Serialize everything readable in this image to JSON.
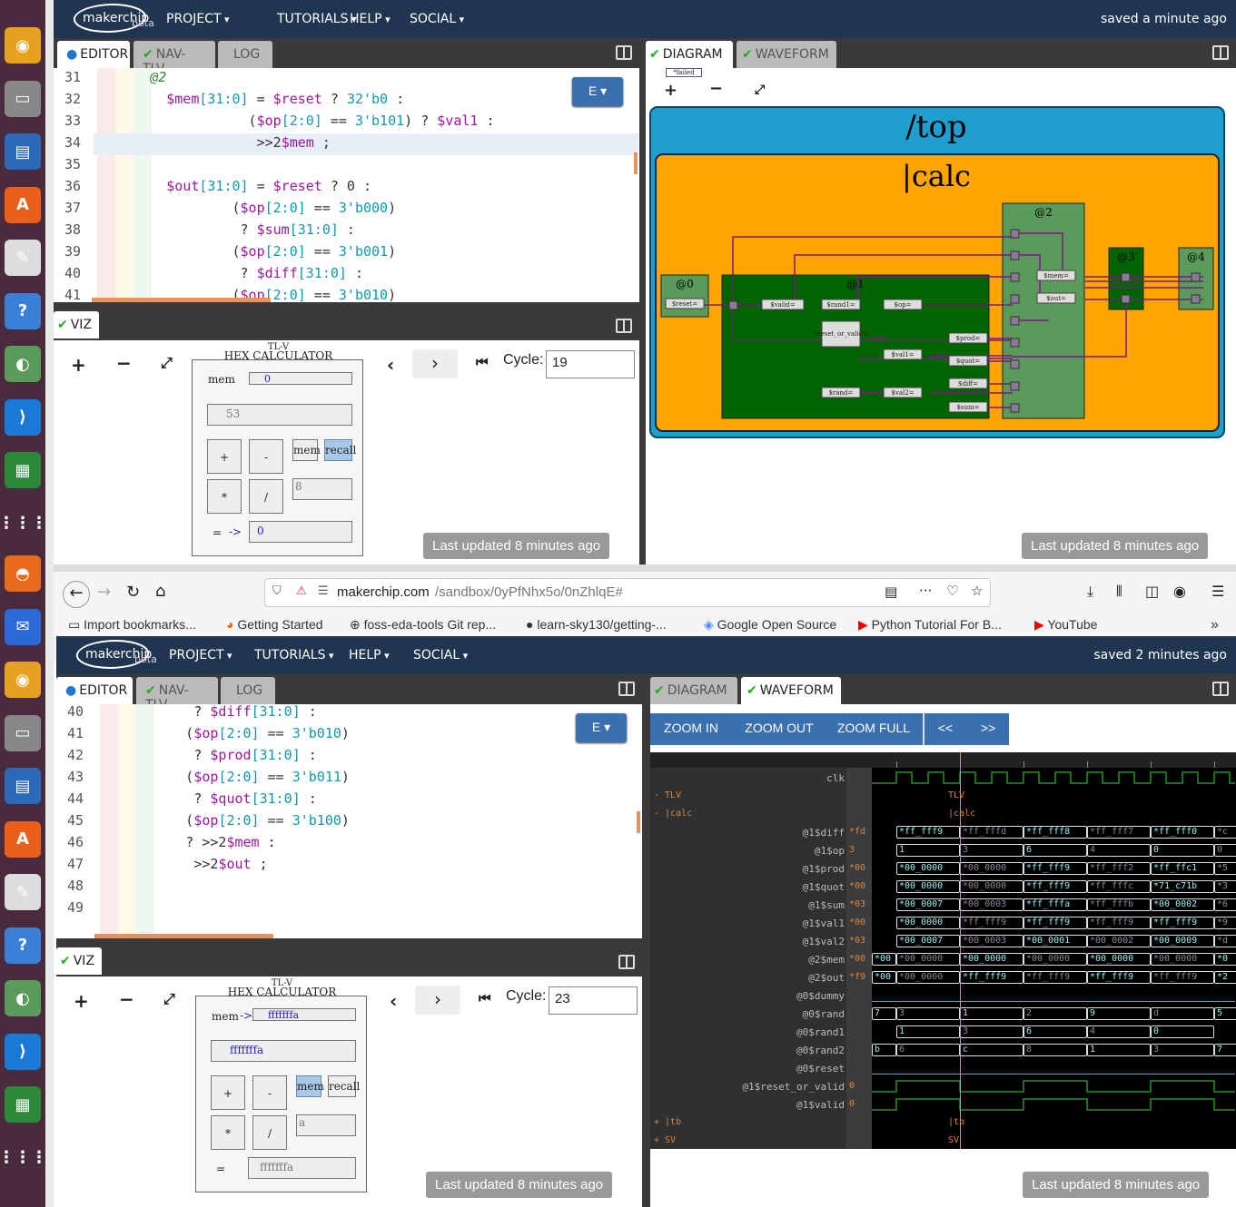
{
  "dock": {
    "icons": [
      "rhythmbox-icon",
      "files-icon",
      "writer-icon",
      "software-icon",
      "text-editor-icon",
      "help-icon",
      "image-viewer-icon",
      "vscode-icon",
      "calc-icon",
      "apps-grid-icon"
    ],
    "icons2": [
      "firefox-icon",
      "thunderbird-icon",
      "rhythmbox-icon",
      "files-icon",
      "writer-icon",
      "software-icon",
      "text-editor-icon",
      "help-icon",
      "image-viewer-icon",
      "vscode-icon",
      "calc-icon",
      "apps-grid-icon"
    ]
  },
  "top": {
    "nav": {
      "logo": "makerchip",
      "beta": "beta",
      "menus": [
        "PROJECT",
        "TUTORIALS",
        "HELP",
        "SOCIAL"
      ],
      "saved": "saved a minute ago"
    },
    "editor_tabs": [
      "EDITOR",
      "NAV-TLV",
      "LOG"
    ],
    "editor_button": "E",
    "lines": [
      {
        "n": "31",
        "t": "@2",
        "cls": "c",
        "ind": "      "
      },
      {
        "n": "32",
        "t": "$mem[31:0] = $reset ? 32'b0 :",
        "ind": "        "
      },
      {
        "n": "33",
        "t": "($op[2:0] == 3'b101) ? $val1 :",
        "ind": "                  "
      },
      {
        "n": "34",
        "t": ">>2$mem ;",
        "ind": "                   "
      },
      {
        "n": "35",
        "t": "",
        "ind": ""
      },
      {
        "n": "36",
        "t": "$out[31:0] = $reset ? 0 :",
        "ind": "        "
      },
      {
        "n": "37",
        "t": "($op[2:0] == 3'b000)",
        "ind": "                "
      },
      {
        "n": "38",
        "t": "? $sum[31:0] :",
        "ind": "                 "
      },
      {
        "n": "39",
        "t": "($op[2:0] == 3'b001)",
        "ind": "                "
      },
      {
        "n": "40",
        "t": "? $diff[31:0] :",
        "ind": "                 "
      },
      {
        "n": "41",
        "t": "($op[2:0] == 3'b010)",
        "ind": "                "
      }
    ],
    "viz_tab": "VIZ",
    "calc": {
      "title": "TL-V",
      "subtitle": "HEX CALCULATOR",
      "mem_label": "mem",
      "mem_value": "0",
      "display": "53",
      "btn_plus": "+",
      "btn_minus": "-",
      "btn_mem": "mem",
      "btn_recall": "recall",
      "btn_mul": "*",
      "btn_div": "/",
      "operand": "8",
      "eq": "=",
      "arrow": "->",
      "result": "0"
    },
    "cycle_label": "Cycle:",
    "cycle": "19",
    "last_updated": "Last updated 8 minutes ago",
    "diagram_tabs": [
      "DIAGRAM",
      "WAVEFORM"
    ],
    "diagram": {
      "failed": "*failed",
      "top": "/top",
      "calc": "|calc",
      "stages": [
        "@0",
        "@1",
        "@2",
        "@3",
        "@4"
      ],
      "signals": [
        "$reset=",
        "$valid=",
        "$rand1=",
        "$op=",
        "$reset_or_valid=",
        "$val1=",
        "$rand=",
        "$val2=",
        "$prod=",
        "$quot=",
        "$diff=",
        "$sum=",
        "$mem=",
        "$out="
      ]
    },
    "diagram_last_updated": "Last updated 8 minutes ago"
  },
  "browser": {
    "url_host": "makerchip.com",
    "url_path": "/sandbox/0yPfNhx5o/0nZhlqE#",
    "bookmarks": [
      "Import bookmarks...",
      "Getting Started",
      "foss-eda-tools Git rep...",
      "learn-sky130/getting-...",
      "Google Open Source",
      "Python Tutorial For B...",
      "YouTube"
    ]
  },
  "bottom": {
    "nav": {
      "logo": "makerchip",
      "beta": "beta",
      "menus": [
        "PROJECT",
        "TUTORIALS",
        "HELP",
        "SOCIAL"
      ],
      "saved": "saved 2 minutes ago"
    },
    "editor_tabs": [
      "EDITOR",
      "NAV-TLV",
      "LOG"
    ],
    "editor_button": "E",
    "lines": [
      {
        "n": "40",
        "t": "? $diff[31:0] :",
        "ind": "           "
      },
      {
        "n": "41",
        "t": "($op[2:0] == 3'b010)",
        "ind": "          "
      },
      {
        "n": "42",
        "t": "? $prod[31:0] :",
        "ind": "           "
      },
      {
        "n": "43",
        "t": "($op[2:0] == 3'b011)",
        "ind": "          "
      },
      {
        "n": "44",
        "t": "? $quot[31:0] :",
        "ind": "           "
      },
      {
        "n": "45",
        "t": "($op[2:0] == 3'b100)",
        "ind": "          "
      },
      {
        "n": "46",
        "t": "? >>2$mem :",
        "ind": "          "
      },
      {
        "n": "47",
        "t": ">>2$out ;",
        "ind": "           "
      },
      {
        "n": "48",
        "t": "",
        "ind": ""
      },
      {
        "n": "49",
        "t": "",
        "ind": ""
      }
    ],
    "viz_tab": "VIZ",
    "calc": {
      "title": "TL-V",
      "subtitle": "HEX CALCULATOR",
      "mem_label": "mem",
      "mem_arrow": "->",
      "mem_value": "fffffffa",
      "display": "fffffffa",
      "btn_plus": "+",
      "btn_minus": "-",
      "btn_mem": "mem",
      "btn_recall": "recall",
      "btn_mul": "*",
      "btn_div": "/",
      "operand": "a",
      "eq": "=",
      "result": "fffffffa"
    },
    "cycle_label": "Cycle:",
    "cycle": "23",
    "last_updated": "Last updated 8 minutes ago",
    "wave_tabs": [
      "DIAGRAM",
      "WAVEFORM"
    ],
    "wave_buttons": [
      "ZOOM IN",
      "ZOOM OUT",
      "ZOOM FULL",
      "<<",
      ">>"
    ],
    "wave": {
      "groups": {
        "tlv": "TLV",
        "calc": "|calc",
        "tb": "|tb",
        "sv": "SV"
      },
      "signals": [
        {
          "name": "clk",
          "first": "",
          "vals": []
        },
        {
          "name": "@1$diff",
          "first": "*fd",
          "vals": [
            "*ff_fff9",
            "*ff_fffd",
            "*ff_fff8",
            "*ff_fff7",
            "*ff_fff0",
            "*c"
          ]
        },
        {
          "name": "@1$op",
          "first": "3",
          "vals": [
            "1",
            "3",
            "6",
            "4",
            "0",
            "0"
          ]
        },
        {
          "name": "@1$prod",
          "first": "*00",
          "vals": [
            "*00_0000",
            "*00_0000",
            "*ff_fff9",
            "*ff_fff2",
            "*ff_ffc1",
            "*5"
          ]
        },
        {
          "name": "@1$quot",
          "first": "*00",
          "vals": [
            "*00_0000",
            "*00_0000",
            "*ff_fff9",
            "*ff_fffc",
            "*71_c71b",
            "*3"
          ]
        },
        {
          "name": "@1$sum",
          "first": "*03",
          "vals": [
            "*00_0007",
            "*00_0003",
            "*ff_fffa",
            "*ff_fffb",
            "*00_0002",
            "*6"
          ]
        },
        {
          "name": "@1$val1",
          "first": "*00",
          "vals": [
            "*00_0000",
            "*ff_fff9",
            "*ff_fff9",
            "*ff_fff9",
            "*ff_fff9",
            "*9"
          ]
        },
        {
          "name": "@1$val2",
          "first": "*03",
          "vals": [
            "*00_0007",
            "*00_0003",
            "*00_0001",
            "*00_0002",
            "*00_0009",
            "*d"
          ]
        },
        {
          "name": "@2$mem",
          "first": "*00",
          "vals": [
            "*00",
            "*00_0000",
            "*00_0000",
            "*00_0000",
            "*00_0000",
            "*00_0000",
            "*0"
          ]
        },
        {
          "name": "@2$out",
          "first": "*f9",
          "vals": [
            "*00",
            "*00_0000",
            "*ff_fff9",
            "*ff_fff9",
            "*ff_fff9",
            "*ff_fff9",
            "*2"
          ]
        },
        {
          "name": "@0$dummy",
          "first": "",
          "vals": []
        },
        {
          "name": "@0$rand",
          "first": "",
          "vals": [
            "7",
            "3",
            "1",
            "2",
            "9",
            "d",
            "5"
          ]
        },
        {
          "name": "@0$rand1",
          "first": "",
          "vals": [
            "1",
            "3",
            "6",
            "4",
            "0"
          ]
        },
        {
          "name": "@0$rand2",
          "first": "",
          "vals": [
            "b",
            "6",
            "c",
            "8",
            "1",
            "3",
            "7"
          ]
        },
        {
          "name": "@0$reset",
          "first": "",
          "vals": []
        },
        {
          "name": "@1$reset_or_valid",
          "first": "0",
          "vals": []
        },
        {
          "name": "@1$valid",
          "first": "0",
          "vals": []
        }
      ]
    },
    "wave_last_updated": "Last updated 8 minutes ago"
  }
}
